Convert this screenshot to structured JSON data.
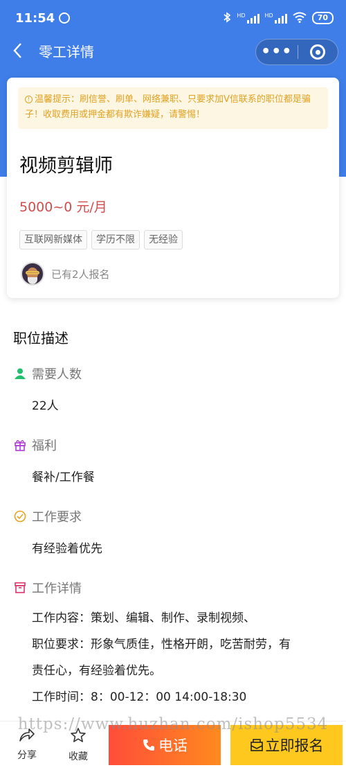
{
  "status_bar": {
    "time": "11:54",
    "battery": "70",
    "net_labels": [
      "HD",
      "HD"
    ]
  },
  "nav": {
    "title": "零工详情",
    "more_label": "•••"
  },
  "notice": {
    "text": "温馨提示：刷信誉、刷单、网络兼职、只要求加V信联系的职位都是骗子！收取费用或押金都有欺诈嫌疑，请警惕！"
  },
  "job": {
    "title": "视频剪辑师",
    "salary": "5000~0 元/月",
    "tags": [
      "互联网新媒体",
      "学历不限",
      "无经验"
    ],
    "applicants": "已有2人报名"
  },
  "description": {
    "section_title": "职位描述",
    "headcount_label": "需要人数",
    "headcount_value": "22人",
    "welfare_label": "福利",
    "welfare_value": "餐补/工作餐",
    "requirement_label": "工作要求",
    "requirement_value": "有经验着优先",
    "details_label": "工作详情",
    "details_lines": [
      "工作内容：策划、编辑、制作、录制视频、",
      "职位要求：形象气质佳，性格开朗，吃苦耐劳，有",
      "责任心，有经验着优先。",
      "工作时间：8：00-12：00 14:00-18:30"
    ]
  },
  "watermark": "https://www.huzhan.com/ishop5534",
  "bottom_bar": {
    "share_label": "分享",
    "favorite_label": "收藏",
    "call_label": "电话",
    "apply_label": "立即报名"
  },
  "colors": {
    "header_blue": "#3f7ee8",
    "salary_red": "#d24c4c",
    "notice_text": "#e0a222",
    "headcount_icon": "#1fbf6b",
    "welfare_icon": "#b23ad8",
    "requirement_icon": "#e8a31b",
    "details_icon": "#e0336b",
    "call_button": "#ff5a32",
    "apply_button": "#ffc81e"
  }
}
